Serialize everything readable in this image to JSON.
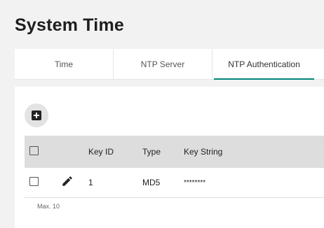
{
  "page": {
    "title": "System Time"
  },
  "tabs": [
    {
      "label": "Time",
      "active": false
    },
    {
      "label": "NTP Server",
      "active": false
    },
    {
      "label": "NTP Authentication",
      "active": true
    }
  ],
  "accent_color": "#00857a",
  "toolbar": {
    "add_icon": "plus-box-icon"
  },
  "table": {
    "columns": [
      "Key ID",
      "Type",
      "Key String"
    ],
    "rows": [
      {
        "key_id": "1",
        "type": "MD5",
        "key_string": "********",
        "edit_icon": "pencil-icon"
      }
    ],
    "footer": "Max. 10"
  }
}
